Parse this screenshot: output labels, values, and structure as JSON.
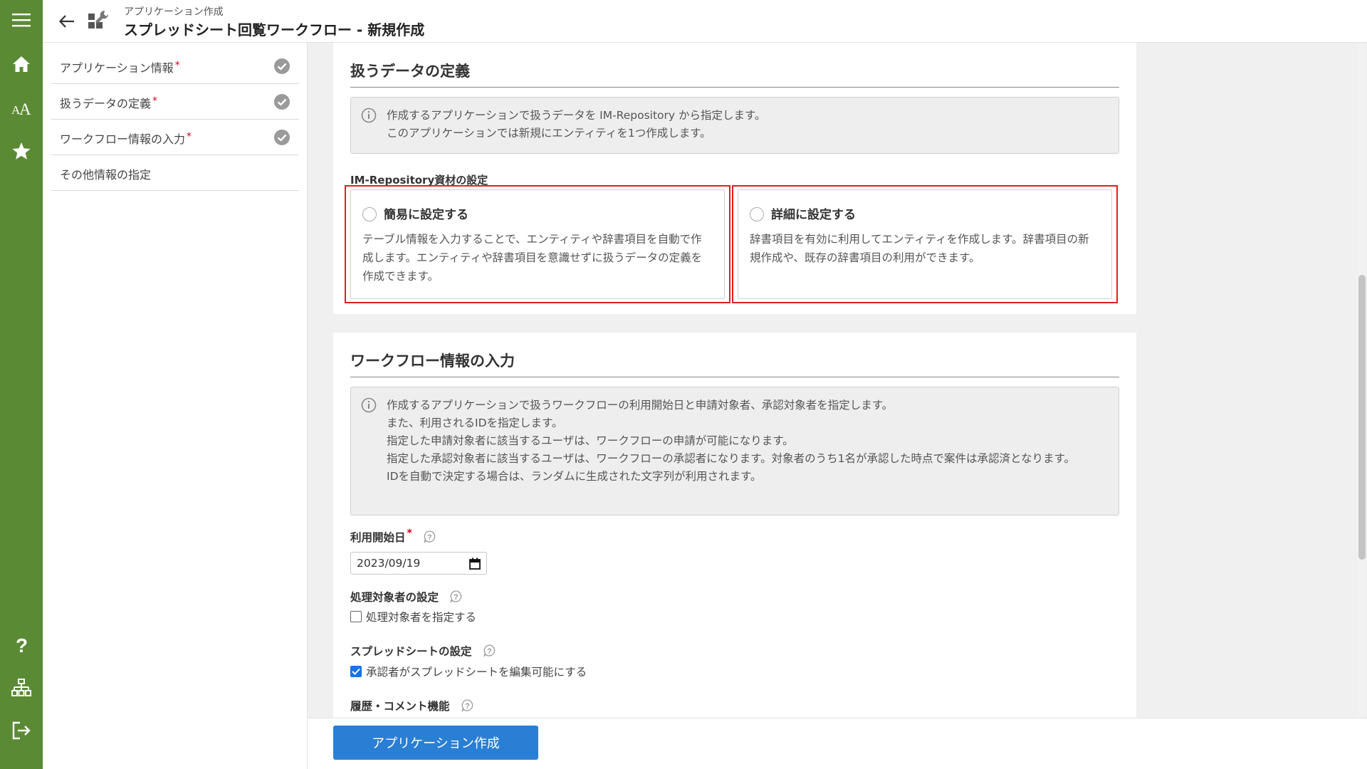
{
  "header": {
    "breadcrumb": "アプリケーション作成",
    "title": "スプレッドシート回覧ワークフロー - 新規作成"
  },
  "rail": {
    "icons": [
      "menu-icon",
      "home-icon",
      "font-icon",
      "star-icon",
      "help-icon",
      "sitemap-icon",
      "logout-icon"
    ],
    "color": "#5b8a35"
  },
  "sidebar": {
    "items": [
      {
        "label": "アプリケーション情報",
        "required": "*",
        "done": true
      },
      {
        "label": "扱うデータの定義",
        "required": "*",
        "done": true
      },
      {
        "label": "ワークフロー情報の入力",
        "required": "*",
        "done": true
      },
      {
        "label": "その他情報の指定",
        "required": "",
        "done": false
      }
    ]
  },
  "data_section": {
    "title": "扱うデータの定義",
    "info_lines": [
      "作成するアプリケーションで扱うデータを IM-Repository から指定します。",
      "このアプリケーションでは新規にエンティティを1つ作成します。"
    ],
    "sub_label": "IM-Repository資材の設定",
    "options": [
      {
        "title": "簡易に設定する",
        "desc": "テーブル情報を入力することで、エンティティや辞書項目を自動で作成します。エンティティや辞書項目を意識せずに扱うデータの定義を作成できます。",
        "selected": false
      },
      {
        "title": "詳細に設定する",
        "desc": "辞書項目を有効に利用してエンティティを作成します。辞書項目の新規作成や、既存の辞書項目の利用ができます。",
        "selected": false
      }
    ]
  },
  "workflow_section": {
    "title": "ワークフロー情報の入力",
    "info_lines": [
      "作成するアプリケーションで扱うワークフローの利用開始日と申請対象者、承認対象者を指定します。",
      "また、利用されるIDを指定します。",
      "指定した申請対象者に該当するユーザは、ワークフローの申請が可能になります。",
      "指定した承認対象者に該当するユーザは、ワークフローの承認者になります。対象者のうち1名が承認した時点で案件は承認済となります。",
      "IDを自動で決定する場合は、ランダムに生成された文字列が利用されます。"
    ],
    "start_date": {
      "label": "利用開始日",
      "required": "*",
      "value": "2023/09/19"
    },
    "target": {
      "label": "処理対象者の設定",
      "checkbox_label": "処理対象者を指定する",
      "checked": false
    },
    "spreadsheet": {
      "label": "スプレッドシートの設定",
      "checkbox_label": "承認者がスプレッドシートを編集可能にする",
      "checked": true
    },
    "history": {
      "label": "履歴・コメント機能"
    }
  },
  "footer": {
    "create_label": "アプリケーション作成",
    "button_color": "#2a7fd4"
  },
  "highlight_color": "#e02020"
}
